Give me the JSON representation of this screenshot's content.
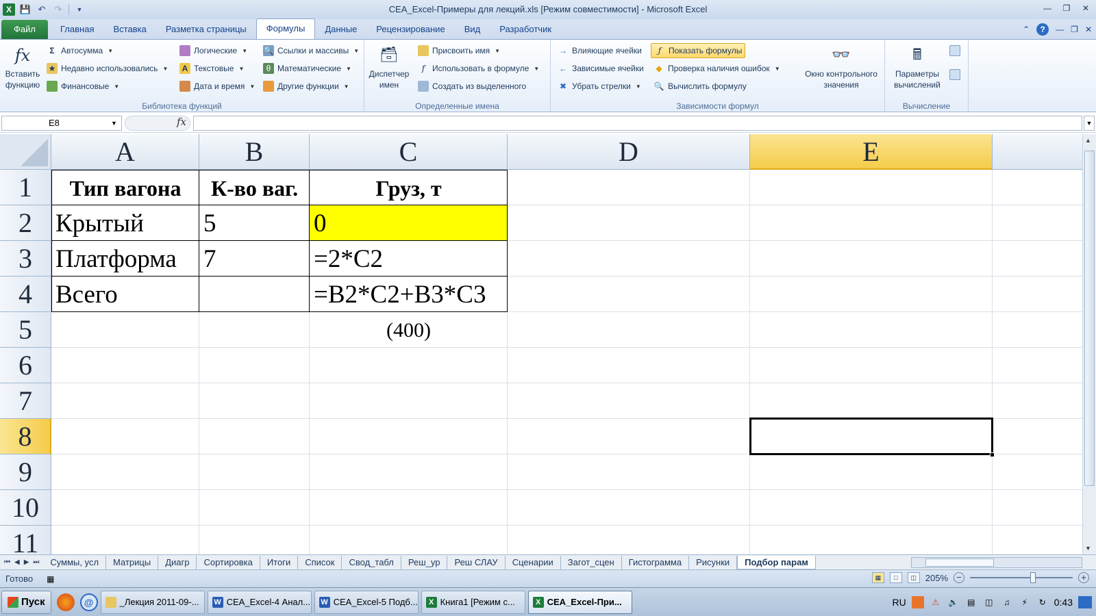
{
  "window": {
    "title": "CEA_Excel-Примеры для лекций.xls  [Режим совместимости]  -  Microsoft Excel"
  },
  "ribbon_tabs": [
    "Файл",
    "Главная",
    "Вставка",
    "Разметка страницы",
    "Формулы",
    "Данные",
    "Рецензирование",
    "Вид",
    "Разработчик"
  ],
  "active_tab": "Формулы",
  "ribbon": {
    "library": {
      "label": "Библиотека функций",
      "insert_function": "Вставить функцию",
      "autosum": "Автосумма",
      "recent": "Недавно использовались",
      "financial": "Финансовые",
      "logical": "Логические",
      "text": "Текстовые",
      "datetime": "Дата и время",
      "lookup": "Ссылки и массивы",
      "math": "Математические",
      "more": "Другие функции"
    },
    "names": {
      "label": "Определенные имена",
      "manager": "Диспетчер имен",
      "define": "Присвоить имя",
      "use_in_formula": "Использовать в формуле",
      "create_from_selection": "Создать из выделенного"
    },
    "auditing": {
      "label": "Зависимости формул",
      "trace_precedents": "Влияющие ячейки",
      "trace_dependents": "Зависимые ячейки",
      "remove_arrows": "Убрать стрелки",
      "show_formulas": "Показать формулы",
      "error_checking": "Проверка наличия ошибок",
      "evaluate": "Вычислить формулу",
      "watch_window": "Окно контрольного значения"
    },
    "calculation": {
      "label": "Вычисление",
      "options": "Параметры вычислений"
    }
  },
  "formula_bar": {
    "name_box": "E8",
    "formula": ""
  },
  "columns": [
    "A",
    "B",
    "C",
    "D",
    "E"
  ],
  "rows": [
    "1",
    "2",
    "3",
    "4",
    "5",
    "6",
    "7",
    "8",
    "9",
    "10",
    "11"
  ],
  "cells": {
    "A1": "Тип вагона",
    "B1": "К-во ваг.",
    "C1": "Груз, т",
    "A2": "Крытый",
    "B2": "5",
    "C2": "0",
    "A3": "Платформа",
    "B3": "7",
    "C3": "=2*C2",
    "A4": "Всего",
    "C4": "=B2*C2+B3*C3",
    "C5": "(400)"
  },
  "colors": {
    "highlight_cell": "#ffff00",
    "selected_header": "#f5cc4a"
  },
  "sheet_tabs": [
    "Суммы, усл",
    "Матрицы",
    "Диагр",
    "Сортировка",
    "Итоги",
    "Список",
    "Свод_табл",
    "Реш_ур",
    "Реш СЛАУ",
    "Сценарии",
    "Загот_сцен",
    "Гистограмма",
    "Рисунки",
    "Подбор парам"
  ],
  "active_sheet": "Подбор парам",
  "status": {
    "ready": "Готово",
    "zoom": "205%"
  },
  "taskbar": {
    "start": "Пуск",
    "tasks": [
      {
        "label": "_Лекция 2011-09-...",
        "icon": "folder-icon"
      },
      {
        "label": "CEA_Excel-4 Анал...",
        "icon": "word-icon"
      },
      {
        "label": "CEA_Excel-5 Подб...",
        "icon": "word-icon"
      },
      {
        "label": "Книга1  [Режим с...",
        "icon": "excel-icon"
      },
      {
        "label": "CEA_Excel-При...",
        "icon": "excel-icon"
      }
    ],
    "lang": "RU",
    "clock": "0:43"
  }
}
